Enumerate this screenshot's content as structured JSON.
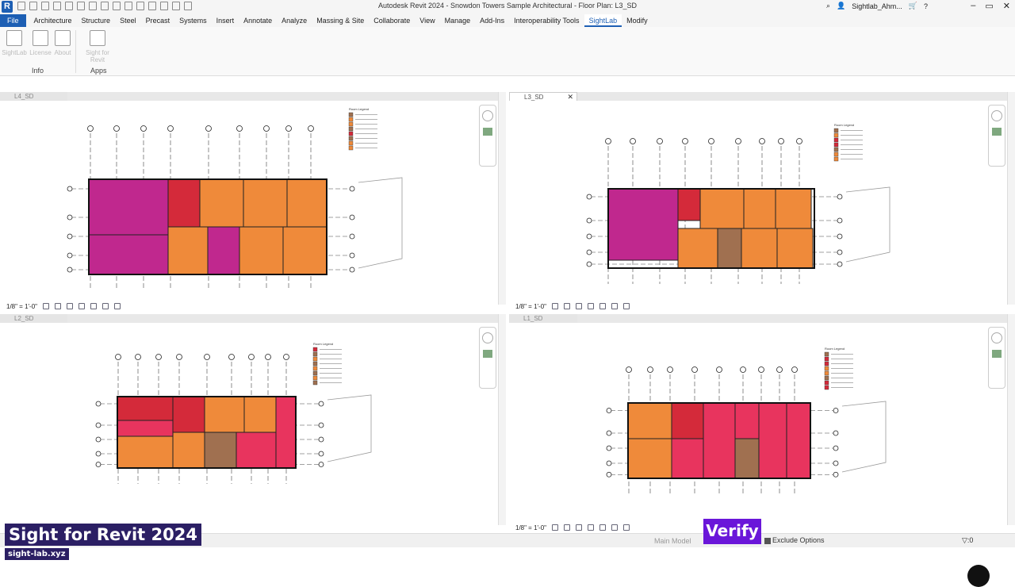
{
  "app": {
    "title": "Autodesk Revit 2024 - Snowdon Towers Sample Architectural - Floor Plan: L3_SD",
    "logo": "R",
    "user": "Sightlab_Ahm...",
    "window_controls": [
      "–",
      "▭",
      "✕"
    ]
  },
  "menu": {
    "tabs": [
      "File",
      "Architecture",
      "Structure",
      "Steel",
      "Precast",
      "Systems",
      "Insert",
      "Annotate",
      "Analyze",
      "Massing & Site",
      "Collaborate",
      "View",
      "Manage",
      "Add-Ins",
      "Interoperability Tools",
      "SightLab",
      "Modify"
    ],
    "active": "SightLab"
  },
  "ribbon": {
    "buttons": [
      "SightLab",
      "License",
      "About",
      "Sight for Revit"
    ],
    "panels": [
      "Info",
      "Apps"
    ]
  },
  "views": [
    {
      "tab": "L4_SD",
      "scale": "1/8\" = 1'-0\"",
      "legend_title": "Room Legend"
    },
    {
      "tab": "L3_SD",
      "scale": "1/8\" = 1'-0\"",
      "legend_title": "Room Legend"
    },
    {
      "tab": "L2_SD",
      "scale": "",
      "legend_title": "Room Legend"
    },
    {
      "tab": "L1_SD",
      "scale": "1/8\" = 1'-0\"",
      "legend_title": "Room Legend"
    }
  ],
  "status": {
    "model": "Main Model",
    "exclude_options": "Exclude Options",
    "filter_count": ":0",
    "selection_count": ":0"
  },
  "overlay": {
    "brand_title": "Sight for Revit 2024",
    "brand_url": "sight-lab.xyz",
    "verify": "Verify !"
  },
  "colors": {
    "orange": "#ef8a3a",
    "magenta": "#c0288e",
    "red": "#d42a3a",
    "pink": "#e8345e",
    "brown": "#a07050",
    "accent": "#1d5fb4",
    "verify_bg": "#6a16d9",
    "brand_bg": "#2b1f64"
  }
}
